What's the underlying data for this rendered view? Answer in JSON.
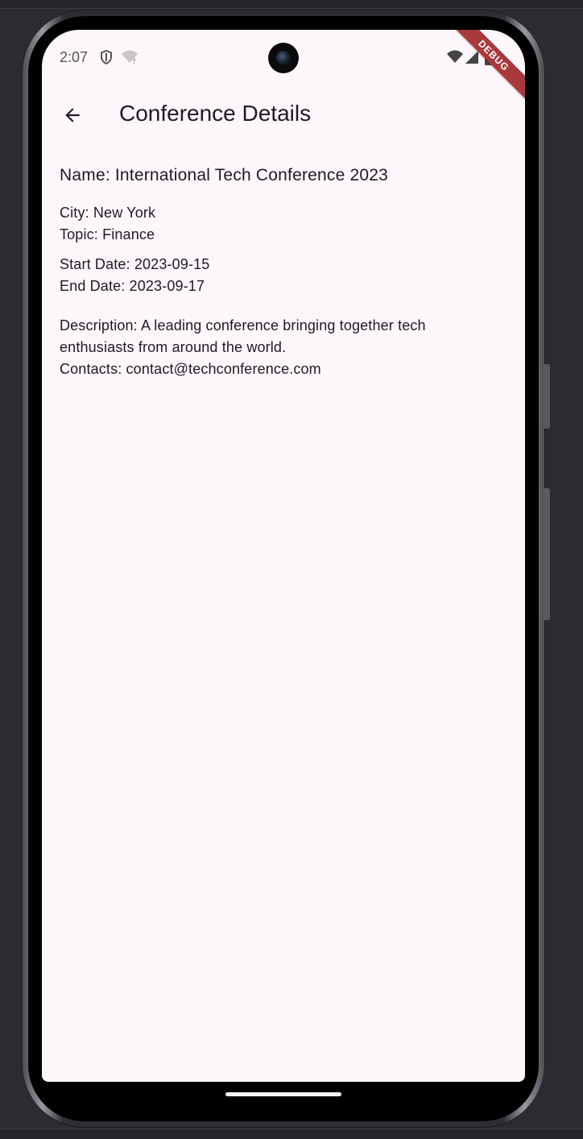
{
  "status_bar": {
    "time": "2:07"
  },
  "debug_banner": {
    "label": "DEBUG"
  },
  "app_bar": {
    "back_icon": "arrow-back-icon",
    "title": "Conference Details"
  },
  "conference": {
    "name": "Name: International Tech Conference 2023",
    "city": "City: New York",
    "topic": "Topic: Finance",
    "start_date": "Start Date: 2023-09-15",
    "end_date": "End Date: 2023-09-17",
    "description": "Description: A leading conference bringing together tech enthusiasts from around the world.",
    "contacts": "Contacts: contact@techconference.com"
  },
  "colors": {
    "background": "#fdf7fc",
    "text": "#1d1b20",
    "debug_ribbon": "#a8393d"
  }
}
